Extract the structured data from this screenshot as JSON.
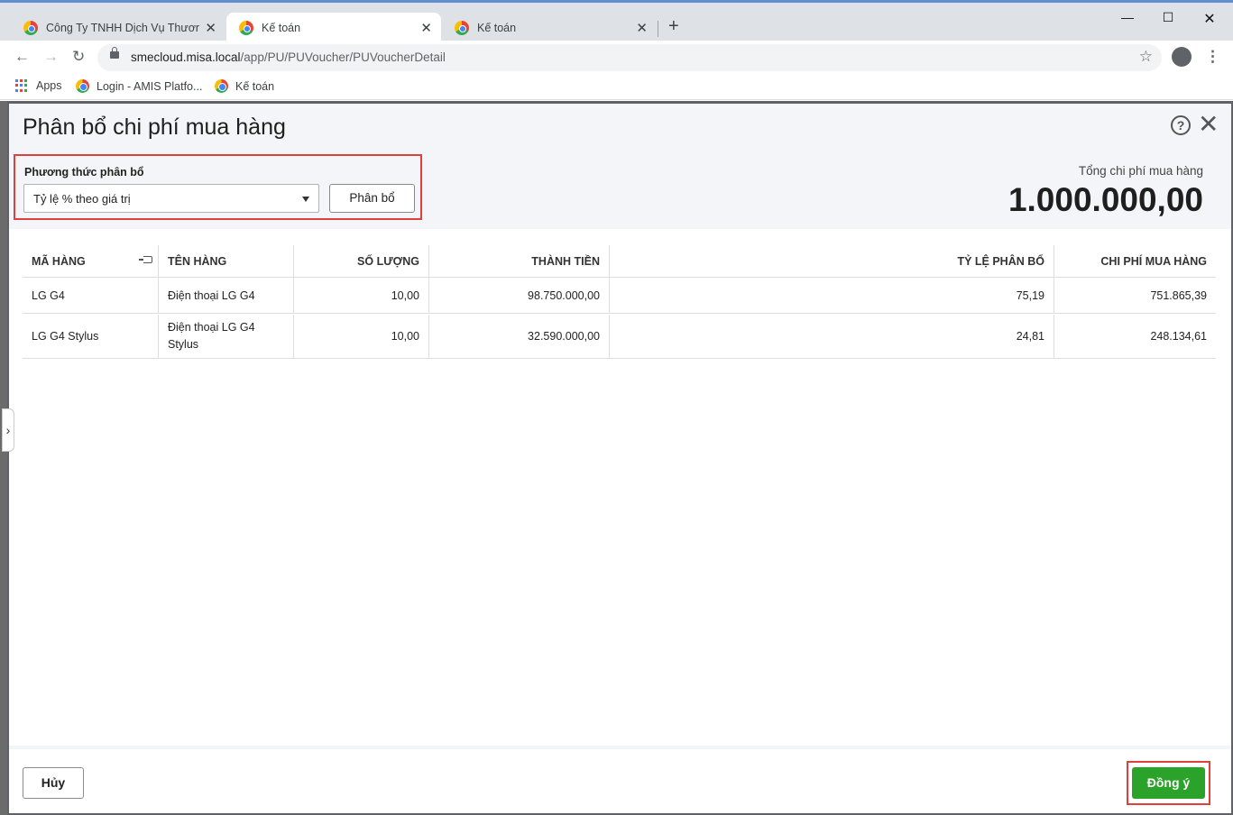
{
  "browser": {
    "tabs": [
      {
        "title": "Công Ty TNHH Dịch Vụ Thương I",
        "active": false
      },
      {
        "title": "Kế toán",
        "active": true
      },
      {
        "title": "Kế toán",
        "active": false
      }
    ],
    "url_host": "smecloud.misa.local",
    "url_path": "/app/PU/PUVoucher/PUVoucherDetail",
    "bookmarks": [
      {
        "label": "Apps"
      },
      {
        "label": "Login - AMIS Platfo..."
      },
      {
        "label": "Kế toán"
      }
    ]
  },
  "dialog": {
    "title": "Phân bổ chi phí mua hàng",
    "method_label": "Phương thức phân bổ",
    "method_value": "Tỷ lệ % theo giá trị",
    "allocate_button": "Phân bổ",
    "total_label": "Tổng chi phí mua hàng",
    "total_value": "1.000.000,00",
    "table": {
      "headers": [
        "MÃ HÀNG",
        "TÊN HÀNG",
        "SỐ LƯỢNG",
        "THÀNH TIỀN",
        "TỶ LỆ PHÂN BỔ",
        "CHI PHÍ MUA HÀNG"
      ],
      "rows": [
        {
          "code": "LG G4",
          "name": "Điện thoại LG G4",
          "qty": "10,00",
          "amount": "98.750.000,00",
          "ratio": "75,19",
          "cost": "751.865,39"
        },
        {
          "code": "LG G4 Stylus",
          "name": "Điện thoại LG G4 Stylus",
          "qty": "10,00",
          "amount": "32.590.000,00",
          "ratio": "24,81",
          "cost": "248.134,61"
        }
      ]
    },
    "cancel_button": "Hủy",
    "ok_button": "Đồng ý"
  },
  "colors": {
    "accent_green": "#2ba229",
    "highlight_red": "#e0403a",
    "header_bg": "#f4f5f8"
  }
}
